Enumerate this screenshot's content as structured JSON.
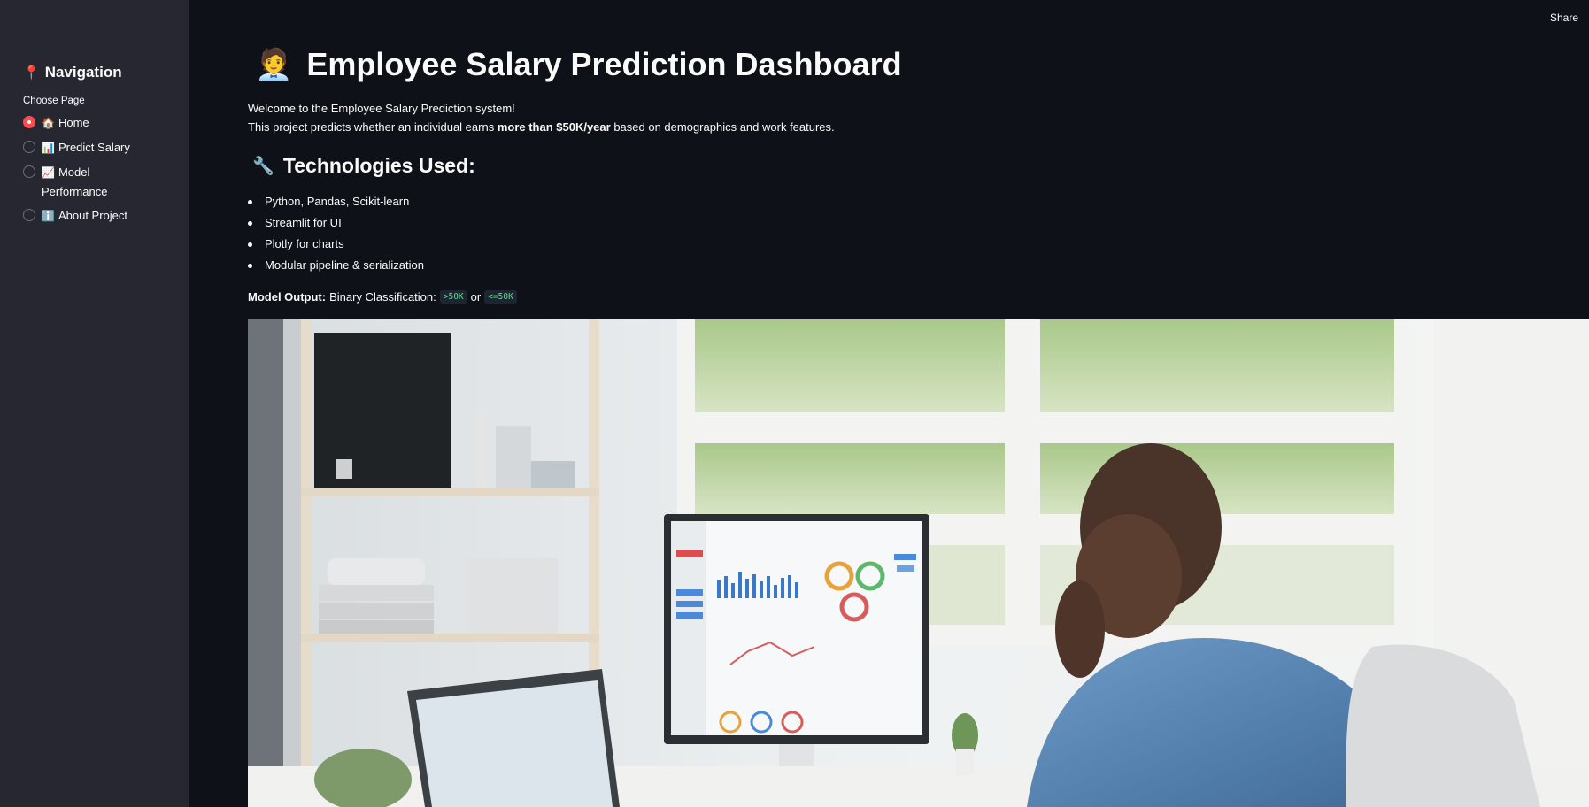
{
  "sidebar": {
    "title_icon": "📍",
    "title": "Navigation",
    "choose_label": "Choose Page",
    "items": [
      {
        "icon": "🏠",
        "label": "Home",
        "checked": true
      },
      {
        "icon": "📊",
        "label": "Predict Salary",
        "checked": false
      },
      {
        "icon": "📈",
        "label": "Model Performance",
        "checked": false
      },
      {
        "icon": "ℹ️",
        "label": "About Project",
        "checked": false
      }
    ]
  },
  "header": {
    "share_label": "Share"
  },
  "main": {
    "title_icon": "🧑‍💼",
    "title": "Employee Salary Prediction Dashboard",
    "intro_line1": "Welcome to the Employee Salary Prediction system!",
    "intro_line2_pre": "This project predicts whether an individual earns ",
    "intro_line2_bold": "more than $50K/year",
    "intro_line2_post": " based on demographics and work features.",
    "tech_title_icon": "🔧",
    "tech_title": "Technologies Used:",
    "tech_items": [
      "Python, Pandas, Scikit-learn",
      "Streamlit for UI",
      "Plotly for charts",
      "Modular pipeline & serialization"
    ],
    "model_output_label": "Model Output:",
    "model_output_text": "Binary Classification:",
    "code_1": ">50K",
    "or_text": "or",
    "code_2": "<=50K"
  },
  "colors": {
    "background": "#0e1117",
    "sidebar": "#262730",
    "accent": "#ff4b4b",
    "code_text": "#5ce488"
  }
}
